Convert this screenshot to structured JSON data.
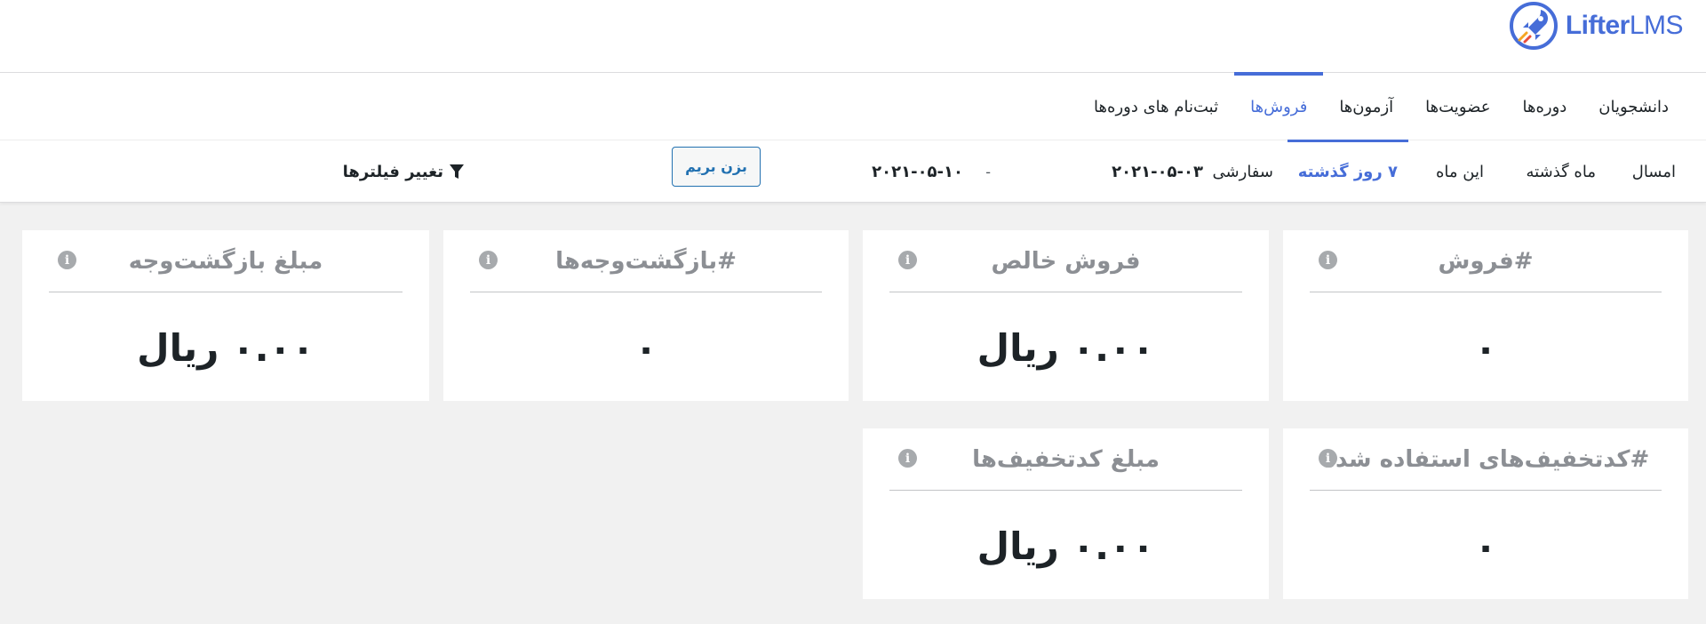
{
  "logo": {
    "name_part1": "Lifter",
    "name_part2": "LMS",
    "brand_color": "#466dd8"
  },
  "tabs": [
    {
      "label": "دانشجویان",
      "active": false
    },
    {
      "label": "دوره‌ها",
      "active": false
    },
    {
      "label": "عضویت‌ها",
      "active": false
    },
    {
      "label": "آزمون‌ها",
      "active": false
    },
    {
      "label": "فروش‌ها",
      "active": true
    },
    {
      "label": "ثبت‌نام های دوره‌ها",
      "active": false
    }
  ],
  "filters": {
    "this_year": "امسال",
    "last_month": "ماه گذشته",
    "this_month": "این ماه",
    "last_7_days": "۷ روز گذشته",
    "custom": "سفارشی",
    "date_start": "۲۰۲۱-۰۵-۰۳",
    "date_separator": "-",
    "date_end": "۲۰۲۱-۰۵-۱۰",
    "go_button": "بزن بریم",
    "change_filters": "تغییر فیلترها"
  },
  "cards": {
    "sales_count": {
      "title": "#فروش",
      "value": "۰"
    },
    "net_sales": {
      "title": "فروش خالص",
      "value": "۰.۰۰ ریال"
    },
    "refunds_count": {
      "title": "#بازگشت‌وجه‌ها",
      "value": "۰"
    },
    "refunds_amount": {
      "title": "مبلغ بازگشت‌وجه",
      "value": "۰.۰۰ ریال"
    },
    "coupons_used": {
      "title": "#کدتخفیف‌های استفاده شده",
      "value": "۰"
    },
    "coupons_amount": {
      "title": "مبلغ کدتخفیف‌ها",
      "value": "۰.۰۰ ریال"
    }
  },
  "info_icon_glyph": "i"
}
